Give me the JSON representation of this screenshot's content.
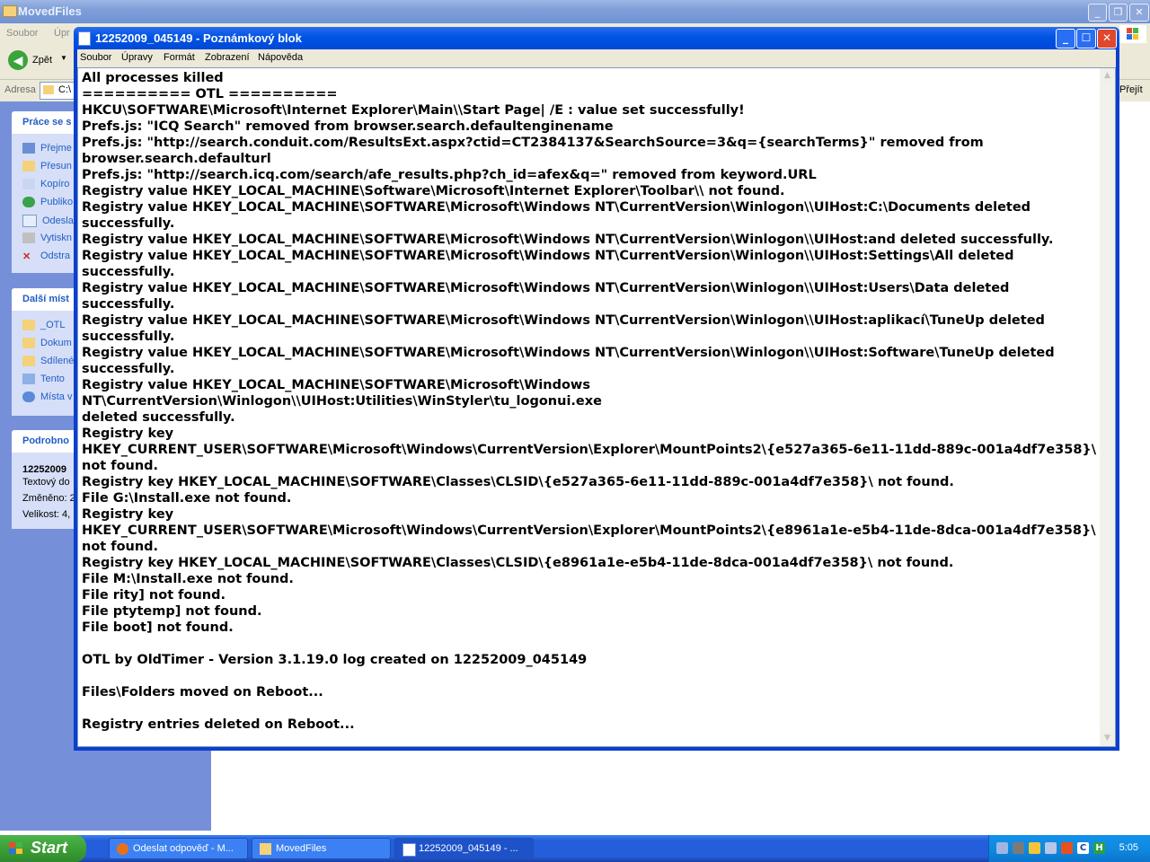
{
  "background_window": {
    "title": "MovedFiles",
    "menu": [
      "Soubor",
      "Úpr"
    ],
    "back_label": "Zpět",
    "address_label": "Adresa",
    "address_value": "C:\\",
    "go_label": "Přejít",
    "tasks_panel": {
      "title": "Práce se s",
      "items": [
        "Přejme",
        "Přesun",
        "Kopíro",
        "Publiko",
        "Odeslat",
        "Vytiskn",
        "Odstra"
      ]
    },
    "places_panel": {
      "title": "Další míst",
      "items": [
        "_OTL",
        "Dokum",
        "Sdílené",
        "Tento",
        "Místa v"
      ]
    },
    "details_panel": {
      "title": "Podrobno",
      "name": "12252009",
      "type": "Textový do",
      "modified": "Změněno: 2",
      "size": "Velikost: 4,"
    }
  },
  "notepad": {
    "title": "12252009_045149 - Poznámkový blok",
    "menu": [
      "Soubor",
      "Úpravy",
      "Formát",
      "Zobrazení",
      "Nápověda"
    ],
    "lines": [
      "All processes killed",
      "========== OTL ==========",
      "HKCU\\SOFTWARE\\Microsoft\\Internet Explorer\\Main\\\\Start Page| /E : value set successfully!",
      "Prefs.js: \"ICQ Search\" removed from browser.search.defaultenginename",
      "Prefs.js: \"http://search.conduit.com/ResultsExt.aspx?ctid=CT2384137&SearchSource=3&q={searchTerms}\" removed from",
      "browser.search.defaulturl",
      "Prefs.js: \"http://search.icq.com/search/afe_results.php?ch_id=afex&q=\" removed from keyword.URL",
      "Registry value HKEY_LOCAL_MACHINE\\Software\\Microsoft\\Internet Explorer\\Toolbar\\\\ not found.",
      "Registry value HKEY_LOCAL_MACHINE\\SOFTWARE\\Microsoft\\Windows NT\\CurrentVersion\\Winlogon\\\\UIHost:C:\\Documents deleted",
      "successfully.",
      "Registry value HKEY_LOCAL_MACHINE\\SOFTWARE\\Microsoft\\Windows NT\\CurrentVersion\\Winlogon\\\\UIHost:and deleted successfully.",
      "Registry value HKEY_LOCAL_MACHINE\\SOFTWARE\\Microsoft\\Windows NT\\CurrentVersion\\Winlogon\\\\UIHost:Settings\\All deleted successfully.",
      "Registry value HKEY_LOCAL_MACHINE\\SOFTWARE\\Microsoft\\Windows NT\\CurrentVersion\\Winlogon\\\\UIHost:Users\\Data deleted successfully.",
      "Registry value HKEY_LOCAL_MACHINE\\SOFTWARE\\Microsoft\\Windows NT\\CurrentVersion\\Winlogon\\\\UIHost:aplikací\\TuneUp deleted",
      "successfully.",
      "Registry value HKEY_LOCAL_MACHINE\\SOFTWARE\\Microsoft\\Windows NT\\CurrentVersion\\Winlogon\\\\UIHost:Software\\TuneUp deleted",
      "successfully.",
      "Registry value HKEY_LOCAL_MACHINE\\SOFTWARE\\Microsoft\\Windows NT\\CurrentVersion\\Winlogon\\\\UIHost:Utilities\\WinStyler\\tu_logonui.exe",
      "deleted successfully.",
      "Registry key",
      "HKEY_CURRENT_USER\\SOFTWARE\\Microsoft\\Windows\\CurrentVersion\\Explorer\\MountPoints2\\{e527a365-6e11-11dd-889c-001a4df7e358}\\",
      "not found.",
      "Registry key HKEY_LOCAL_MACHINE\\SOFTWARE\\Classes\\CLSID\\{e527a365-6e11-11dd-889c-001a4df7e358}\\ not found.",
      "File G:\\Install.exe not found.",
      "Registry key",
      "HKEY_CURRENT_USER\\SOFTWARE\\Microsoft\\Windows\\CurrentVersion\\Explorer\\MountPoints2\\{e8961a1e-e5b4-11de-8dca-001a4df7e358}\\",
      "not found.",
      "Registry key HKEY_LOCAL_MACHINE\\SOFTWARE\\Classes\\CLSID\\{e8961a1e-e5b4-11de-8dca-001a4df7e358}\\ not found.",
      "File M:\\Install.exe not found.",
      "File rity] not found.",
      "File ptytemp] not found.",
      "File boot] not found.",
      "",
      "OTL by OldTimer - Version 3.1.19.0 log created on 12252009_045149",
      "",
      "Files\\Folders moved on Reboot...",
      "",
      "Registry entries deleted on Reboot..."
    ]
  },
  "taskbar": {
    "start_label": "Start",
    "tasks": [
      {
        "label": "Odeslat odpověď - M...",
        "icon": "firefox-icon"
      },
      {
        "label": "MovedFiles",
        "icon": "folder-icon"
      },
      {
        "label": "12252009_045149 - ...",
        "icon": "notepad-icon",
        "active": true
      }
    ],
    "clock": "5:05"
  }
}
